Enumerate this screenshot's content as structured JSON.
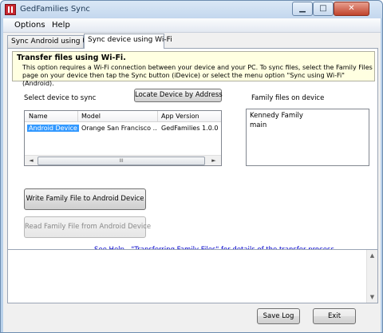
{
  "window": {
    "title": "GedFamilies Sync",
    "minimize_glyph": "▁",
    "maximize_glyph": "□",
    "close_glyph": "✕"
  },
  "menu": {
    "items": [
      "Options",
      "Help"
    ]
  },
  "tabs": [
    {
      "label": "Sync Android using USB",
      "active": false
    },
    {
      "label": "Sync device using Wi-Fi",
      "active": true
    }
  ],
  "info": {
    "title": "Transfer files using Wi-Fi.",
    "text": "This option requires a Wi-Fi connection between your device and your PC.  To sync files, select the Family Files page on your device then tap the Sync button (iDevice) or select the menu option \"Sync using Wi-Fi\" (Android)."
  },
  "select_device_label": "Select device to sync",
  "locate_button_label": "Locate Device by Address",
  "family_files_label": "Family files on device",
  "device_list": {
    "columns": [
      "Name",
      "Model",
      "App Version"
    ],
    "rows": [
      {
        "name": "Android Device",
        "model": "Orange San Francisco ...",
        "app_version": "GedFamilies 1.0.0",
        "selected": true
      }
    ],
    "scroll_left_glyph": "◄",
    "scroll_right_glyph": "►",
    "scroll_thumb_glyph": "III"
  },
  "family_files": [
    "Kennedy Family",
    "main"
  ],
  "write_button_label": "Write Family File to Android Device",
  "read_button_label": "Read Family File from Android Device",
  "help_link": "See Help - \"Transferring Family Files\" for details of the transfer process",
  "log": {
    "text": "",
    "scroll_up_glyph": "▲",
    "scroll_down_glyph": "▼"
  },
  "footer": {
    "save_log_label": "Save Log",
    "exit_label": "Exit"
  }
}
